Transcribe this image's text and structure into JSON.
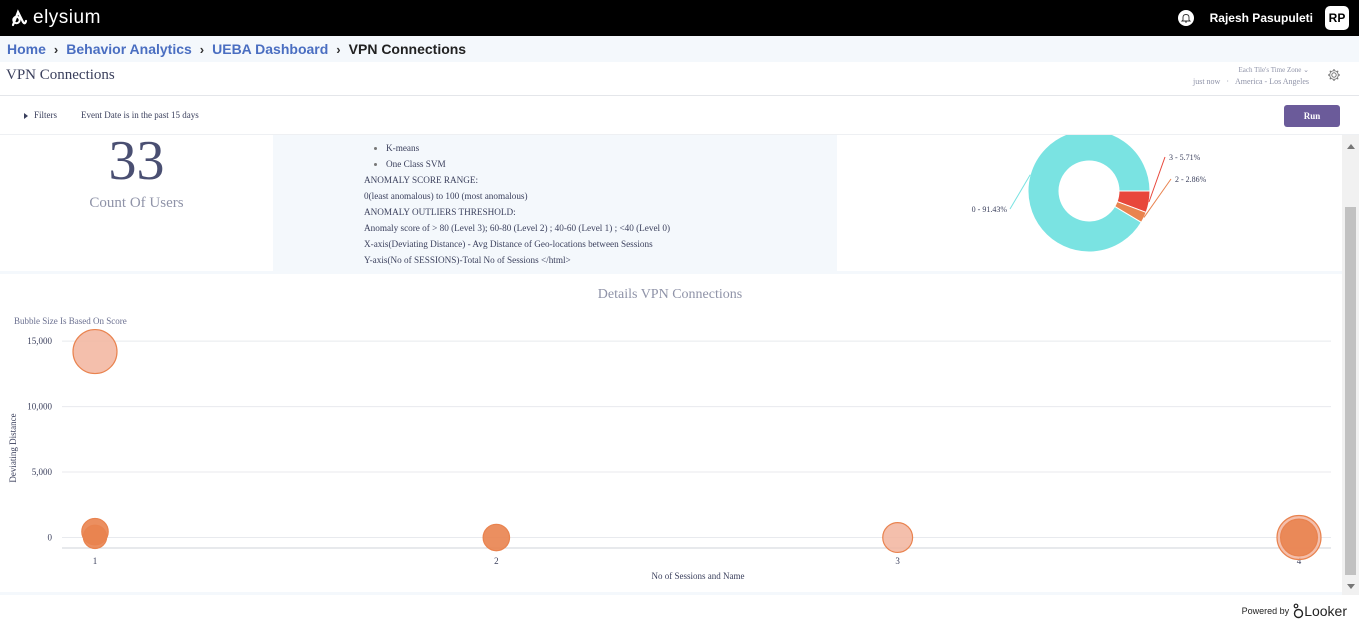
{
  "app": {
    "name": "elysium"
  },
  "user": {
    "name": "Rajesh Pasupuleti",
    "initials": "RP"
  },
  "breadcrumb": {
    "items": [
      "Home",
      "Behavior Analytics",
      "UEBA Dashboard"
    ],
    "current": "VPN Connections",
    "separator": "›"
  },
  "dashboard": {
    "title": "VPN Connections",
    "timezone_label": "Each Tile's Time Zone",
    "last_run": "just now",
    "timezone": "America - Los Angeles"
  },
  "filters": {
    "toggle_label": "Filters",
    "summary": "Event Date is in the past 15 days",
    "run_label": "Run"
  },
  "tiles": {
    "users": {
      "value": "33",
      "label": "Count Of Users"
    },
    "text": {
      "bullets": [
        "K-means",
        "One Class SVM"
      ],
      "lines": [
        "ANOMALY SCORE RANGE:",
        "0(least anomalous) to 100 (most anomalous)",
        "ANOMALY OUTLIERS THRESHOLD:",
        "Anomaly score of > 80 (Level 3); 60-80 (Level 2) ; 40-60 (Level 1) ; <40 (Level 0)",
        "X-axis(Deviating Distance) - Avg Distance of Geo-locations between Sessions",
        "Y-axis(No of SESSIONS)-Total No of Sessions </html>"
      ]
    }
  },
  "colors": {
    "accent": "#6b5b9a",
    "donut_0": "#7ae3e2",
    "donut_3": "#e8473b",
    "donut_2": "#e9834f",
    "bubble_fill": "#f2b49e",
    "bubble_stroke": "#e9834f",
    "bubble_dark": "#e9834f"
  },
  "chart_data": [
    {
      "type": "pie",
      "style": "donut",
      "slices": [
        {
          "label": "0 - 91.43%",
          "value": 91.43,
          "color": "#7ae3e2"
        },
        {
          "label": "3 - 5.71%",
          "value": 5.71,
          "color": "#e8473b"
        },
        {
          "label": "2 - 2.86%",
          "value": 2.86,
          "color": "#e9834f"
        }
      ]
    },
    {
      "type": "scatter",
      "style": "bubble",
      "title": "Details VPN Connections",
      "note": "Bubble Size Is Based On Score",
      "xlabel": "No of Sessions and Name",
      "ylabel": "Deviating Distance",
      "xlim": [
        1,
        4
      ],
      "ylim": [
        -800,
        16000
      ],
      "xticks": [
        "1",
        "2",
        "3",
        "4"
      ],
      "yticks": [
        {
          "value": 0,
          "label": "0"
        },
        {
          "value": 5000,
          "label": "5,000"
        },
        {
          "value": 10000,
          "label": "10,000"
        },
        {
          "value": 15000,
          "label": "15,000"
        }
      ],
      "points": [
        {
          "x": 1,
          "y": 14200,
          "size": 100,
          "shade": "light"
        },
        {
          "x": 1,
          "y": 450,
          "size": 36,
          "shade": "dark"
        },
        {
          "x": 1,
          "y": 50,
          "size": 28,
          "shade": "dark"
        },
        {
          "x": 2,
          "y": 0,
          "size": 36,
          "shade": "dark"
        },
        {
          "x": 3,
          "y": 0,
          "size": 46,
          "shade": "light"
        },
        {
          "x": 4,
          "y": 0,
          "size": 100,
          "shade": "light"
        },
        {
          "x": 4,
          "y": 0,
          "size": 70,
          "shade": "dark"
        }
      ]
    }
  ],
  "footer": {
    "powered_by": "Powered by",
    "brand": "Looker"
  }
}
